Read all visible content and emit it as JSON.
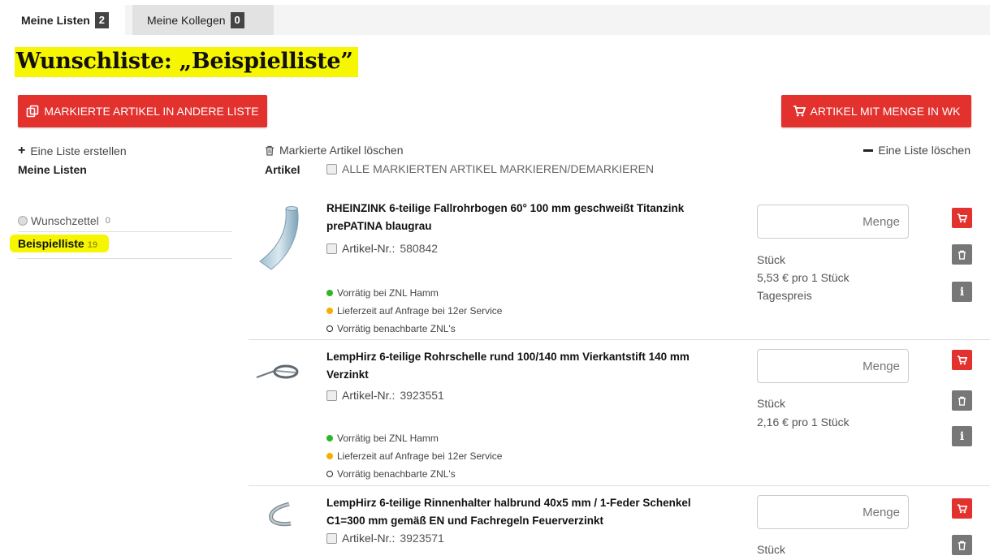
{
  "tabs": [
    {
      "label": "Meine Listen",
      "count": "2"
    },
    {
      "label": "Meine Kollegen",
      "count": "0"
    }
  ],
  "title": "Wunschliste: „Beispielliste”",
  "toolbar": {
    "move_label": "MARKIERTE ARTIKEL IN ANDERE LISTE",
    "cart_label": "ARTIKEL MIT MENGE IN WK",
    "create_list": "Eine Liste erstellen",
    "delete_marked": "Markierte Artikel löschen",
    "delete_list": "Eine Liste löschen"
  },
  "headers": {
    "lists": "Meine Listen",
    "articles": "Artikel",
    "mark_all": "ALLE MARKIERTEN ARTIKEL MARKIEREN/DEMARKIEREN"
  },
  "lists": [
    {
      "name": "Wunschzettel",
      "count": "0"
    },
    {
      "name": "Beispielliste",
      "count": "19"
    }
  ],
  "article_nr_label": "Artikel-Nr.:",
  "qty_placeholder": "Menge",
  "products": [
    {
      "name": "RHEINZINK 6-teilige Fallrohrbogen 60° 100 mm geschweißt Titanzink prePATINA blaugrau",
      "article_nr": "580842",
      "unit": "Stück",
      "price": "5,53 € pro  1  Stück",
      "price_note": "Tagespreis",
      "stock_1": "Vorrätig bei ZNL Hamm",
      "stock_2": "Lieferzeit auf Anfrage bei 12er Service",
      "stock_3": "Vorrätig benachbarte ZNL's"
    },
    {
      "name": "LempHirz 6-teilige Rohrschelle rund 100/140 mm Vierkantstift 140 mm Verzinkt",
      "article_nr": "3923551",
      "unit": "Stück",
      "price": "2,16 € pro  1  Stück",
      "stock_1": "Vorrätig bei ZNL Hamm",
      "stock_2": "Lieferzeit auf Anfrage bei 12er Service",
      "stock_3": "Vorrätig benachbarte ZNL's"
    },
    {
      "name": "LempHirz 6-teilige Rinnenhalter halbrund 40x5 mm / 1-Feder Schenkel C1=300 mm gemäß EN und Fachregeln Feuerverzinkt",
      "article_nr": "3923571",
      "unit": "Stück"
    }
  ],
  "colors": {
    "accent_red": "#e3312e",
    "highlight": "#f6f600",
    "stock_green": "#2fb52d",
    "stock_orange": "#f4b000"
  }
}
